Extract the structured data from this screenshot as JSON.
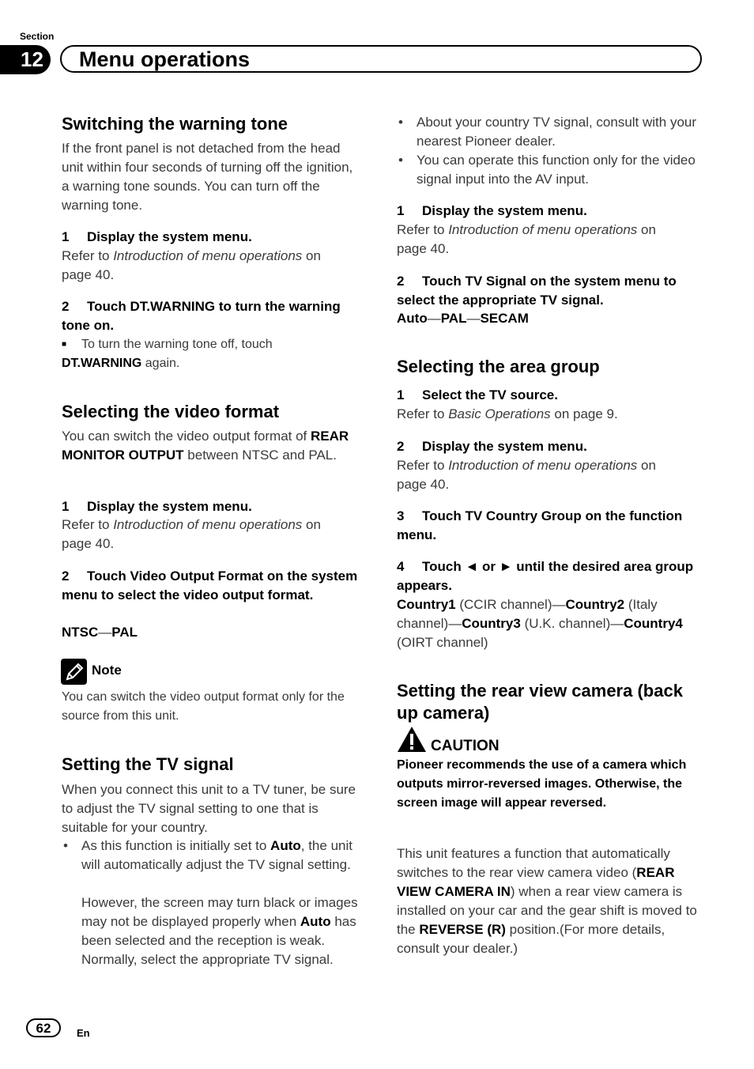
{
  "header": {
    "section_label": "Section",
    "section_number": "12",
    "title": "Menu operations"
  },
  "left": {
    "warning_tone": {
      "heading": "Switching the warning tone",
      "intro": "If the front panel is not detached from the head unit within four seconds of turning off the ignition, a warning tone sounds. You can turn off the warning tone.",
      "step1_num": "1",
      "step1": "Display the system menu.",
      "step1_ref_pre": "Refer to ",
      "step1_ref_link": "Introduction of menu operations",
      "step1_ref_post": " on page 40.",
      "step2_num": "2",
      "step2": "Touch DT.WARNING to turn the warning tone on.",
      "tip_pre": "To turn the warning tone off, touch",
      "tip_bold": "DT.WARNING",
      "tip_post": " again."
    },
    "video_format": {
      "heading": "Selecting the video format",
      "intro_pre": "You can switch the video output format of ",
      "intro_bold": "REAR MONITOR OUTPUT",
      "intro_post": " between NTSC and PAL.",
      "step1_num": "1",
      "step1": "Display the system menu.",
      "step1_ref_pre": "Refer to ",
      "step1_ref_link": "Introduction of menu operations",
      "step1_ref_post": " on page 40.",
      "step2_num": "2",
      "step2": "Touch Video Output Format on the system menu to select the video output format.",
      "opt1": "NTSC",
      "sep": "—",
      "opt2": "PAL",
      "note_label": "Note",
      "note_text": "You can switch the video output format only for the source from this unit."
    },
    "tv_signal": {
      "heading": "Setting the TV signal",
      "intro": "When you connect this unit to a TV tuner, be sure to adjust the TV signal setting to one that is suitable for your country.",
      "bullet1_pre": "As this function is initially set to ",
      "bullet1_bold": "Auto",
      "bullet1_post": ", the unit will automatically adjust the TV signal setting.",
      "bullet1_cont_pre": "However, the screen may turn black or images may not be displayed properly when ",
      "bullet1_cont_bold": "Auto",
      "bullet1_cont_post": " has been selected and the reception is weak. Normally, select the appropriate TV signal."
    }
  },
  "right": {
    "tv_signal_cont": {
      "bullet2": "About your country TV signal, consult with your nearest Pioneer dealer.",
      "bullet3": "You can operate this function only for the video signal input into the AV input.",
      "step1_num": "1",
      "step1": "Display the system menu.",
      "step1_ref_pre": "Refer to ",
      "step1_ref_link": "Introduction of menu operations",
      "step1_ref_post": " on page 40.",
      "step2_num": "2",
      "step2": "Touch TV Signal on the system menu to select the appropriate TV signal.",
      "opt1": "Auto",
      "opt2": "PAL",
      "opt3": "SECAM",
      "sep": "—"
    },
    "area_group": {
      "heading": "Selecting the area group",
      "step1_num": "1",
      "step1": "Select the TV source.",
      "step1_ref_pre": "Refer to ",
      "step1_ref_link": "Basic Operations",
      "step1_ref_post": " on page 9.",
      "step2_num": "2",
      "step2": "Display the system menu.",
      "step2_ref_pre": "Refer to ",
      "step2_ref_link": "Introduction of menu operations",
      "step2_ref_post": " on page 40.",
      "step3_num": "3",
      "step3": "Touch TV Country Group on the function menu.",
      "step4_num": "4",
      "step4": "Touch ◄ or ► until the desired area group appears.",
      "c1": "Country1",
      "c1d": " (CCIR channel)",
      "c2": "Country2",
      "c2d": " (Italy channel)",
      "c3": "Country3",
      "c3d": " (U.K. channel)",
      "c4": "Country4",
      "c4d": " (OIRT channel)",
      "sep": "—"
    },
    "rear_camera": {
      "heading": "Setting the rear view camera (back up camera)",
      "caution_label": "CAUTION",
      "caution_text": "Pioneer recommends the use of a camera which outputs mirror-reversed images. Otherwise, the screen image will appear reversed.",
      "body_pre": "This unit features a function that automatically switches to the rear view camera video (",
      "body_bold1": "REAR VIEW CAMERA IN",
      "body_mid": ") when a rear view camera is installed on your car and the gear shift is moved to the ",
      "body_bold2": "REVERSE (R)",
      "body_post": "  position.(For more details, consult your dealer.)"
    }
  },
  "footer": {
    "page_number": "62",
    "language": "En"
  }
}
